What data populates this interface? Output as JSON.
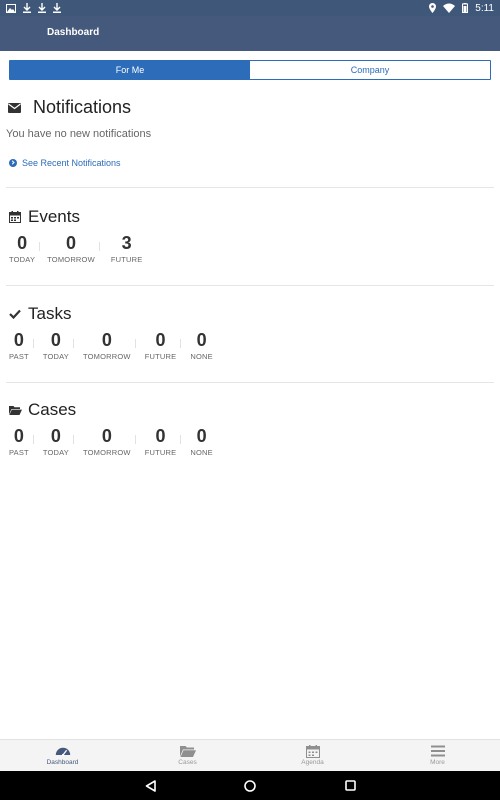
{
  "status_bar": {
    "time": "5:11",
    "left_icons": [
      "image-icon",
      "download-icon",
      "download-icon",
      "download-icon"
    ],
    "right_icons": [
      "location-icon",
      "wifi-icon",
      "battery-icon"
    ]
  },
  "header": {
    "title": "Dashboard"
  },
  "tabs": [
    {
      "label": "For Me",
      "active": true
    },
    {
      "label": "Company",
      "active": false
    }
  ],
  "notifications": {
    "title": "Notifications",
    "empty_text": "You have no new notifications",
    "link_label": "See Recent Notifications"
  },
  "events": {
    "title": "Events",
    "stats": [
      {
        "value": "0",
        "label": "TODAY"
      },
      {
        "value": "0",
        "label": "TOMORROW"
      },
      {
        "value": "3",
        "label": "FUTURE"
      }
    ]
  },
  "tasks": {
    "title": "Tasks",
    "stats": [
      {
        "value": "0",
        "label": "PAST"
      },
      {
        "value": "0",
        "label": "TODAY"
      },
      {
        "value": "0",
        "label": "TOMORROW"
      },
      {
        "value": "0",
        "label": "FUTURE"
      },
      {
        "value": "0",
        "label": "NONE"
      }
    ]
  },
  "cases": {
    "title": "Cases",
    "stats": [
      {
        "value": "0",
        "label": "PAST"
      },
      {
        "value": "0",
        "label": "TODAY"
      },
      {
        "value": "0",
        "label": "TOMORROW"
      },
      {
        "value": "0",
        "label": "FUTURE"
      },
      {
        "value": "0",
        "label": "NONE"
      }
    ]
  },
  "bottom_nav": [
    {
      "label": "Dashboard",
      "icon": "gauge-icon",
      "active": true
    },
    {
      "label": "Cases",
      "icon": "folder-icon",
      "active": false
    },
    {
      "label": "Agenda",
      "icon": "calendar-icon",
      "active": false
    },
    {
      "label": "More",
      "icon": "menu-icon",
      "active": false
    }
  ],
  "colors": {
    "header": "#44597b",
    "accent": "#2c6cb9"
  }
}
